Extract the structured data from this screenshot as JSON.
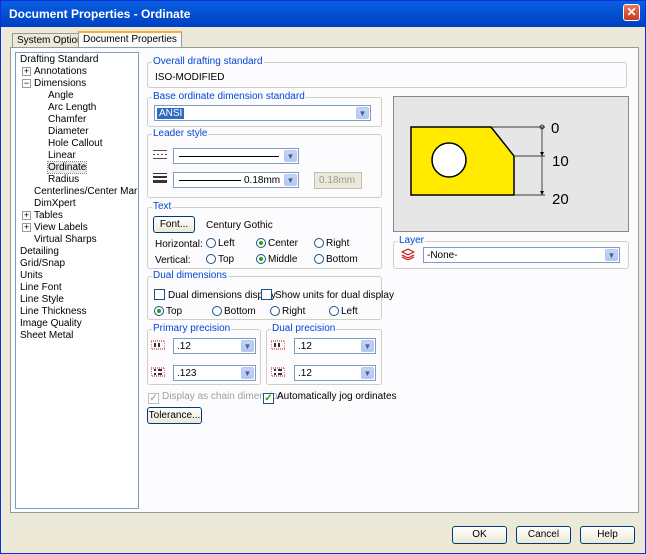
{
  "window": {
    "title": "Document Properties - Ordinate"
  },
  "tabs": [
    {
      "label": "System Options"
    },
    {
      "label": "Document Properties"
    }
  ],
  "tree": {
    "items": [
      {
        "label": "Drafting Standard"
      },
      {
        "label": "Annotations",
        "expander": "+"
      },
      {
        "label": "Dimensions",
        "expander": "−"
      },
      {
        "label": "Angle"
      },
      {
        "label": "Arc Length"
      },
      {
        "label": "Chamfer"
      },
      {
        "label": "Diameter"
      },
      {
        "label": "Hole Callout"
      },
      {
        "label": "Linear"
      },
      {
        "label": "Ordinate"
      },
      {
        "label": "Radius"
      },
      {
        "label": "Centerlines/Center Marks"
      },
      {
        "label": "DimXpert"
      },
      {
        "label": "Tables",
        "expander": "+"
      },
      {
        "label": "View Labels",
        "expander": "+"
      },
      {
        "label": "Virtual Sharps"
      },
      {
        "label": "Detailing"
      },
      {
        "label": "Grid/Snap"
      },
      {
        "label": "Units"
      },
      {
        "label": "Line Font"
      },
      {
        "label": "Line Style"
      },
      {
        "label": "Line Thickness"
      },
      {
        "label": "Image Quality"
      },
      {
        "label": "Sheet Metal"
      }
    ]
  },
  "overall_standard": {
    "title": "Overall drafting standard",
    "value": "ISO-MODIFIED"
  },
  "base_standard": {
    "title": "Base ordinate dimension standard",
    "value": "ANSI"
  },
  "leader_style": {
    "title": "Leader style",
    "thickness": "0.18mm",
    "custom_thickness": "0.18mm"
  },
  "text": {
    "title": "Text",
    "font_button": "Font...",
    "font_name": "Century Gothic",
    "horizontal_label": "Horizontal:",
    "horizontal_options": [
      "Left",
      "Center",
      "Right"
    ],
    "vertical_label": "Vertical:",
    "vertical_options": [
      "Top",
      "Middle",
      "Bottom"
    ]
  },
  "dual_dimensions": {
    "title": "Dual dimensions",
    "display_label": "Dual dimensions display",
    "show_units_label": "Show units for dual display",
    "positions": [
      "Top",
      "Bottom",
      "Right",
      "Left"
    ]
  },
  "primary_precision": {
    "title": "Primary precision",
    "value1": ".12",
    "value2": ".123"
  },
  "dual_precision": {
    "title": "Dual precision",
    "value1": ".12",
    "value2": ".12"
  },
  "chain_label": "Display as chain dimension",
  "jog_label": "Automatically jog ordinates",
  "tolerance_button": "Tolerance...",
  "preview": {
    "labels": [
      "0",
      "10",
      "20"
    ]
  },
  "layer": {
    "title": "Layer",
    "value": "-None-"
  },
  "buttons": {
    "ok": "OK",
    "cancel": "Cancel",
    "help": "Help"
  },
  "colors": {
    "part_fill": "#ffea00",
    "accent": "#0046d5"
  }
}
